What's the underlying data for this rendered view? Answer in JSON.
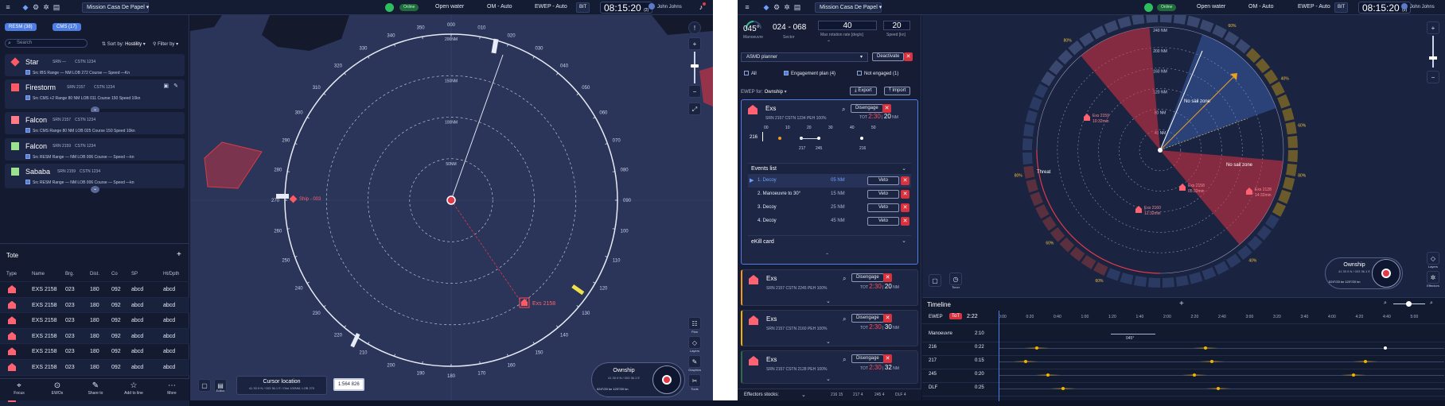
{
  "left_app": {
    "title": "Mission Casa De Papel",
    "online": "Online",
    "sea": "Open water",
    "om": "OM - Auto",
    "ewep": "EWEP - Auto",
    "bit": "BIT",
    "time": "08:15:20",
    "time_sub": "(2)",
    "user": "John Johns",
    "chips": [
      "RESM (38)",
      "CMS (17)"
    ],
    "search_placeholder": "Search",
    "sort": "Sort by",
    "sort_val": "Hostility",
    "filter": "Filter by",
    "tracks": [
      {
        "name": "Star",
        "srn": "SRN —",
        "cstn": "CSTN 1234",
        "row": "Src IBS  Range — NM  LOB 272  Course —  Speed —Kn",
        "color": "#ff5964"
      },
      {
        "name": "Firestorm",
        "srn": "SRN 2157",
        "cstn": "CSTN 1234",
        "row": "Src CMS +2  Range 80 NM  LOB 011  Course 150  Speed 10kn",
        "color": "#ff5964"
      },
      {
        "name": "Falcon",
        "srn": "SRN 2157",
        "cstn": "CSTN 1234",
        "row": "Src CMS  Range 80 NM  LOB 025  Course 150  Speed 10kn",
        "color": "#ff7c86"
      },
      {
        "name": "Falcon",
        "srn": "SRN 2159",
        "cstn": "CSTN 1234",
        "row": "Src RESM  Range — NM  LOB 006  Course —  Speed —kn",
        "color": "#9be28e"
      },
      {
        "name": "Sababa",
        "srn": "SRN 2159",
        "cstn": "CSTN 1234",
        "row": "Src RESM  Range — NM  LOB 006  Course —  Speed —kn",
        "color": "#9be28e"
      }
    ],
    "tote": "Tote",
    "tote_headers": [
      "Type",
      "Name",
      "Brg.",
      "Dist.",
      "Co",
      "SP",
      "Ht/Dpth"
    ],
    "tote_rows": [
      [
        "EXS 2158",
        "023",
        "180",
        "092",
        "abcd",
        "abcd"
      ],
      [
        "EXS 2158",
        "023",
        "180",
        "092",
        "abcd",
        "abcd"
      ],
      [
        "EXS 2158",
        "023",
        "180",
        "092",
        "abcd",
        "abcd"
      ],
      [
        "EXS 2158",
        "023",
        "180",
        "092",
        "abcd",
        "abcd"
      ],
      [
        "EXS 2158",
        "023",
        "180",
        "092",
        "abcd",
        "abcd"
      ],
      [
        "EXS 2158",
        "023",
        "180",
        "092",
        "abcd",
        "abcd"
      ],
      [
        "EXS 2158",
        "023",
        "180",
        "092",
        "abcd",
        "abcd"
      ],
      [
        "EXS 2158",
        "023",
        "180",
        "092",
        "abcd",
        "abcd"
      ]
    ],
    "bottom_nav": [
      "Focus",
      "EWOs",
      "Share to",
      "Add to line",
      "More"
    ],
    "map": {
      "ring_labels": [
        "50NM",
        "100NM",
        "150NM",
        "200NM"
      ],
      "bearings": [
        "000",
        "010",
        "020",
        "030",
        "040",
        "050",
        "060",
        "070",
        "080",
        "090",
        "100",
        "110",
        "120",
        "130",
        "140",
        "150",
        "160",
        "170",
        "180",
        "190",
        "200",
        "210",
        "220",
        "230",
        "240",
        "250",
        "260",
        "270",
        "280",
        "290",
        "300",
        "310",
        "320",
        "330",
        "340",
        "350"
      ],
      "ship_label": "Ship - 003",
      "exs_label": "Exs 2158",
      "cursor_title": "Cursor location",
      "cursor_value": "41 30.9 N / 003 36.1 E / Dist 100NM, LOB 270",
      "scale": "1:564 826",
      "ownship": "Ownship",
      "ownship_sub": "41 30.9 N / 003 36.1 E",
      "ownship_stats": "024°/20 kn  120°/20 kn",
      "editor": "Editor",
      "plan": "Plan",
      "layers": "Layers",
      "graphics": "Graphics",
      "tools": "Tools"
    }
  },
  "right_app": {
    "title": "Mission Casa De Papel",
    "online": "Online",
    "sea": "Open water",
    "om": "OM - Auto",
    "ewep": "EWEP - Auto",
    "bit": "BIT",
    "time": "08:15:20",
    "time_sub": "(2)",
    "user": "John Johns",
    "manoeuvre_val": "045°",
    "manoeuvre_lbl": "Manoeuvre",
    "sector_val": "024 - 068",
    "sector_lbl": "Sector",
    "max_rot_val": "40",
    "max_rot_lbl": "Max rotation rate [deg/s]",
    "speed_val": "20",
    "speed_lbl": "Speed [kn]",
    "planner": "ASMD planner",
    "deactivate": "Deactivate",
    "filters": [
      "All",
      "Engagement plan (4)",
      "Not engaged (1)"
    ],
    "ewep_for": "EWEP for:",
    "ewep_for_val": "Ownship",
    "export": "Export",
    "import": "Import",
    "engage_cards": [
      {
        "title": "Exs",
        "meta": "SRN 2157   CSTN 1234   PEH 100%",
        "tot_red": "2:30",
        "tot_white": "20",
        "unit": "NM",
        "btn": "Disengage",
        "accent": "#4e7de3"
      },
      {
        "title": "Exs",
        "meta": "SRN 2157   CSTN 2245   PEH 100%",
        "tot_red": "2:30",
        "tot_white": "20",
        "unit": "NM",
        "btn": "Disengage",
        "accent": "#f39a1e"
      },
      {
        "title": "Exs",
        "meta": "SRN 2157   CSTN 2160   PEH 100%",
        "tot_red": "2:30",
        "tot_white": "30",
        "unit": "NM",
        "btn": "Disengage",
        "accent": "#f0b400"
      },
      {
        "title": "Exs",
        "meta": "SRN 2157   CSTN 2128   PEH 100%",
        "tot_red": "2:30",
        "tot_white": "32",
        "unit": "NM",
        "btn": "Disengage",
        "accent": "#2f6a47"
      }
    ],
    "tot": "TOT",
    "slider_ticks": [
      "00",
      "10",
      "20",
      "30",
      "40",
      "50"
    ],
    "slider_row": "216",
    "slider_labels": [
      "217",
      "245",
      "216"
    ],
    "events_title": "Events list",
    "events": [
      {
        "name": "1. Decoy",
        "dist": "05 NM",
        "btn": "Veto"
      },
      {
        "name": "2. Manoeuvre to 30°",
        "dist": "15 NM",
        "btn": "Veto"
      },
      {
        "name": "3. Decoy",
        "dist": "25 NM",
        "btn": "Veto"
      },
      {
        "name": "4. Decoy",
        "dist": "45 NM",
        "btn": "Veto"
      }
    ],
    "ekill": "eKill card",
    "effectors": "Effectors stocks:",
    "effector_vals": [
      "216 15",
      "217 4",
      "245 4",
      "DLF 4"
    ],
    "radar": {
      "zones": [
        "No sail zone",
        "No sail zone",
        "Threat"
      ],
      "targets": [
        {
          "l": "Exs 2159",
          "t": "10:32min"
        },
        {
          "l": "Exs 2158",
          "t": "05:32min"
        },
        {
          "l": "Exs 2128",
          "t": "14:32min"
        },
        {
          "l": "Exs 2160",
          "t": "12:32min"
        }
      ],
      "rings": [
        "40 NM",
        "80 NM",
        "120 NM",
        "160 NM",
        "200 NM",
        "240 NM"
      ],
      "pcts": [
        "80%",
        "80%",
        "60%",
        "40%",
        "60%",
        "80%",
        "40%",
        "60%",
        "60%",
        "80%"
      ],
      "ownship": "Ownship",
      "ownship_sub": "41 30.9 N / 003 36.1 E",
      "ownship_stats": "024°/20 kn  120°/20 kn",
      "layers": "Layers",
      "effectors_btn": "Effectors",
      "timer": "Timer"
    },
    "timeline": {
      "title": "Timeline",
      "ewep": "EWEP",
      "tot_lbl": "ToT",
      "tot_val": "2:22",
      "ticks": [
        "0:00",
        "0:20",
        "0:40",
        "1:00",
        "1:20",
        "1:40",
        "2:00",
        "2:20",
        "2:40",
        "3:00",
        "3:20",
        "3:40",
        "4:00",
        "4:20",
        "4:40",
        "5:00"
      ],
      "rows": [
        {
          "n": "Manoeuvre",
          "v": "2:10"
        },
        {
          "n": "216",
          "v": "0:22"
        },
        {
          "n": "217",
          "v": "0:15"
        },
        {
          "n": "245",
          "v": "0:20"
        },
        {
          "n": "DLF",
          "v": "0:25"
        }
      ],
      "mano_label": "045°"
    }
  }
}
